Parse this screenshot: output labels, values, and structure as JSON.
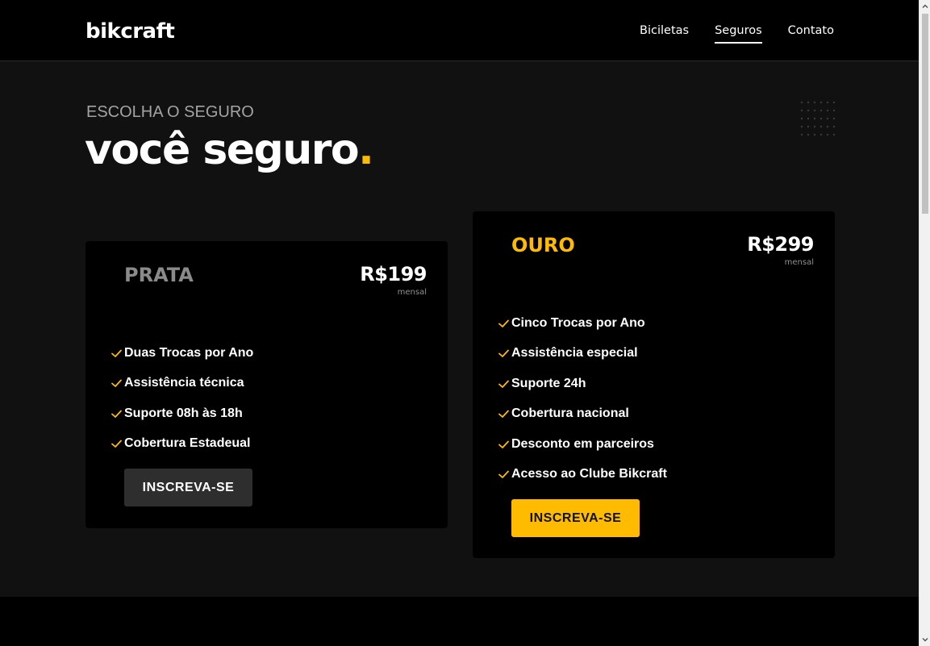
{
  "header": {
    "logo": "bikcraft",
    "nav": [
      {
        "label": "Biciletas",
        "active": false
      },
      {
        "label": "Seguros",
        "active": true
      },
      {
        "label": "Contato",
        "active": false
      }
    ]
  },
  "hero": {
    "subtitle": "ESCOLHA O SEGURO",
    "headline": "você seguro",
    "headline_dot": "."
  },
  "plans": [
    {
      "name": "PRATA",
      "price": "R$199",
      "period": "mensal",
      "features": [
        "Duas Trocas por Ano",
        "Assistência técnica",
        "Suporte 08h às 18h",
        "Cobertura Estadeual"
      ],
      "button_label": "INSCREVA-SE"
    },
    {
      "name": "OURO",
      "price": "R$299",
      "period": "mensal",
      "features": [
        "Cinco Trocas por Ano",
        "Assistência especial",
        "Suporte 24h",
        "Cobertura nacional",
        "Desconto em parceiros",
        "Acesso ao Clube Bikcraft"
      ],
      "button_label": "INSCREVA-SE"
    }
  ],
  "icons": {
    "feature_icon": "check-icon",
    "decoration": "dots-grid-icon"
  },
  "colors": {
    "accent": "#ffbb00",
    "background": "#111111",
    "header": "#000000",
    "card": "#000000",
    "prata_name": "#8a8a8a",
    "prata_button": "#2e2e2e"
  }
}
